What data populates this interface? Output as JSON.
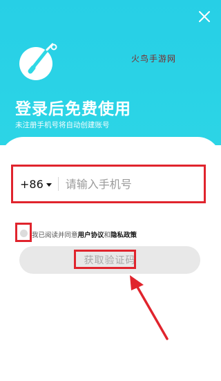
{
  "header": {
    "watermark": "火鸟手游网",
    "title": "登录后免费使用",
    "subtitle": "未注册手机号将自动创建账号"
  },
  "icons": {
    "close": "close-icon",
    "logo": "app-logo-icon",
    "caret": "chevron-down-icon",
    "arrow": "arrow-annotation"
  },
  "login": {
    "country_code": "+86",
    "phone_placeholder": "请输入手机号",
    "phone_value": "",
    "agree_prefix": "我已阅读并同意",
    "user_agreement": "用户协议",
    "agree_and": "和",
    "privacy_policy": "隐私政策",
    "agreed": false,
    "get_code_label": "获取验证码"
  },
  "colors": {
    "background": "#2fd8e5",
    "annotation_red": "#e0242d",
    "button_disabled": "#e8e8e8"
  }
}
